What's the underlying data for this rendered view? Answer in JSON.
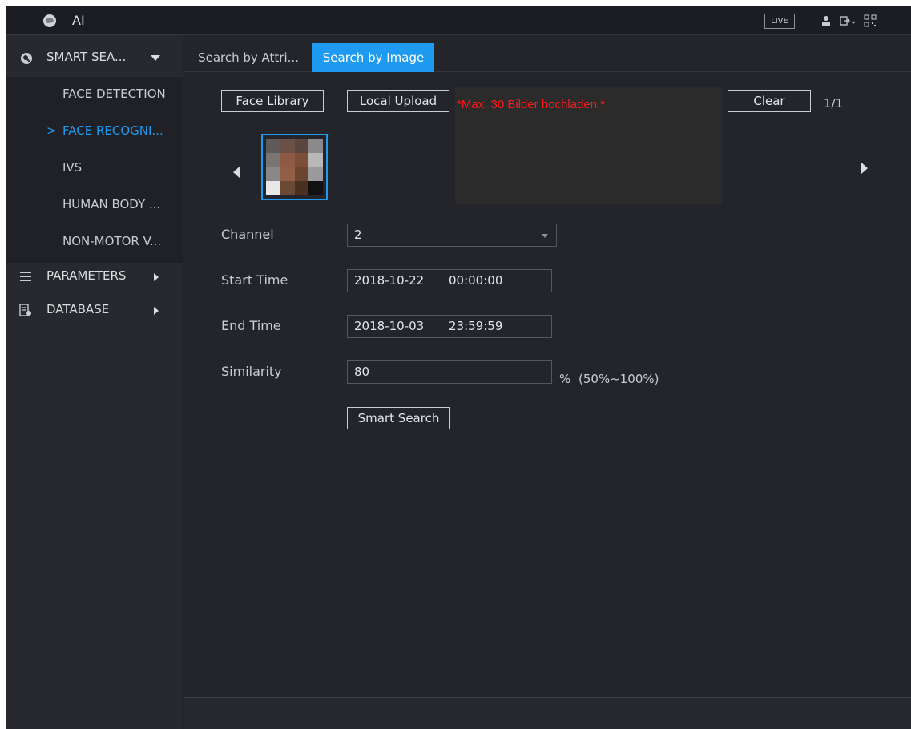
{
  "title_bar": {
    "app_title": "AI",
    "live_label": "LIVE",
    "icons": [
      "brain-icon",
      "user-icon",
      "logout-icon",
      "qr-code-icon"
    ]
  },
  "sidebar": {
    "header": {
      "label": "SMART SEA...",
      "icon": "smart-search-icon"
    },
    "items": [
      {
        "label": "FACE DETECTION",
        "active": false
      },
      {
        "label": "FACE RECOGNI...",
        "active": true
      },
      {
        "label": "IVS",
        "active": false
      },
      {
        "label": "HUMAN BODY ...",
        "active": false
      },
      {
        "label": "NON-MOTOR V...",
        "active": false
      }
    ],
    "sections": [
      {
        "label": "PARAMETERS",
        "icon": "list-icon"
      },
      {
        "label": "DATABASE",
        "icon": "database-icon"
      }
    ],
    "active_chevron": ">"
  },
  "tabs": [
    {
      "label": "Search by Attri...",
      "active": false
    },
    {
      "label": "Search by Image",
      "active": true
    }
  ],
  "image_panel": {
    "face_library_label": "Face Library",
    "local_upload_label": "Local Upload",
    "warning_text": "*Max. 30 Bilder hochladen.*",
    "clear_label": "Clear",
    "pager": "1/1"
  },
  "form": {
    "channel_label": "Channel",
    "channel_value": "2",
    "start_time_label": "Start Time",
    "start_date": "2018-10-22",
    "start_time": "00:00:00",
    "end_time_label": "End Time",
    "end_date": "2018-10-03",
    "end_time": "23:59:59",
    "similarity_label": "Similarity",
    "similarity_value": "80",
    "percent_sign": "%",
    "similarity_range": "(50%~100%)",
    "smart_search_label": "Smart Search"
  },
  "colors": {
    "accent": "#1e9bf0",
    "background": "#23252b",
    "sidebar": "#27292f",
    "warning": "#ff1a1a"
  }
}
